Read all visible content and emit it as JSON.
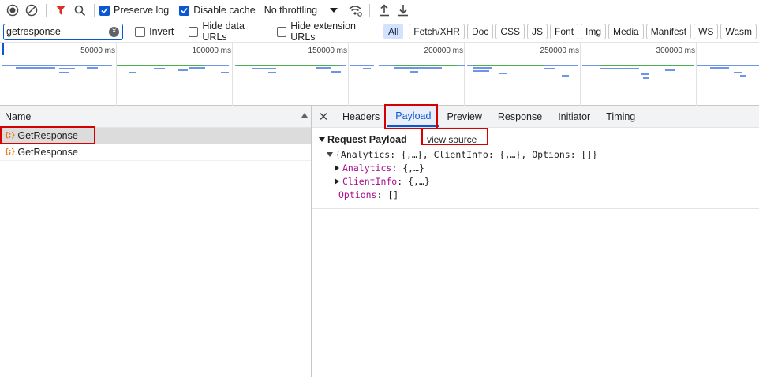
{
  "toolbar": {
    "preserve_log": "Preserve log",
    "disable_cache": "Disable cache",
    "throttling": "No throttling"
  },
  "filter": {
    "value": "getresponse",
    "invert": "Invert",
    "hide_data_urls": "Hide data URLs",
    "hide_extension_urls": "Hide extension URLs",
    "chips": [
      "All",
      "Fetch/XHR",
      "Doc",
      "CSS",
      "JS",
      "Font",
      "Img",
      "Media",
      "Manifest",
      "WS",
      "Wasm"
    ]
  },
  "overview": {
    "ticks": [
      "50000 ms",
      "100000 ms",
      "150000 ms",
      "200000 ms",
      "250000 ms",
      "300000 ms"
    ]
  },
  "requests": {
    "column_name": "Name",
    "rows": [
      {
        "name": "GetResponse",
        "icon": "{;}"
      },
      {
        "name": "GetResponse",
        "icon": "{;}"
      }
    ]
  },
  "detail": {
    "tabs": [
      "Headers",
      "Payload",
      "Preview",
      "Response",
      "Initiator",
      "Timing"
    ],
    "active_tab": "Payload",
    "section_title": "Request Payload",
    "view_source": "view source",
    "root_line": "{Analytics: {,…}, ClientInfo: {,…}, Options: []}",
    "items": [
      {
        "key": "Analytics",
        "value": "{,…}"
      },
      {
        "key": "ClientInfo",
        "value": "{,…}"
      }
    ],
    "options_key": "Options",
    "options_value": "[]"
  },
  "colors": {
    "accent": "#0b57d0",
    "highlight": "#d50000",
    "fetch_icon": "#e8710a",
    "key": "#a90e8e"
  }
}
